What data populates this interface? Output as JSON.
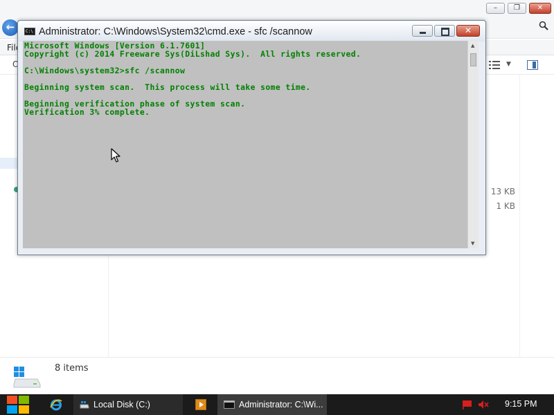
{
  "explorer": {
    "menu_file": "File",
    "cmdbar_partial": "O",
    "file_sizes": [
      "13 KB",
      "1 KB"
    ],
    "status": {
      "items_count": "8 items"
    }
  },
  "cmd_window": {
    "title": "Administrator: C:\\Windows\\System32\\cmd.exe - sfc  /scannow",
    "icon_label": "C:\\",
    "lines": [
      "Microsoft Windows [Version 6.1.7601]",
      "Copyright (c) 2014 Freeware Sys(DiLshad Sys).  All rights reserved.",
      "",
      "C:\\Windows\\system32>sfc /scannow",
      "",
      "Beginning system scan.  This process will take some time.",
      "",
      "Beginning verification phase of system scan.",
      "Verification 3% complete."
    ],
    "text_color": "#008000",
    "background_color": "#c0c0c0"
  },
  "taskbar": {
    "explorer_task_label": "Local Disk (C:)",
    "cmd_task_label": "Administrator: C:\\Wi...",
    "clock": "9:15 PM"
  },
  "icons": {
    "start": "windows-logo-icon",
    "ie": "internet-explorer-icon",
    "media": "media-player-icon",
    "flag": "action-center-flag-icon",
    "volume": "speaker-muted-icon"
  }
}
